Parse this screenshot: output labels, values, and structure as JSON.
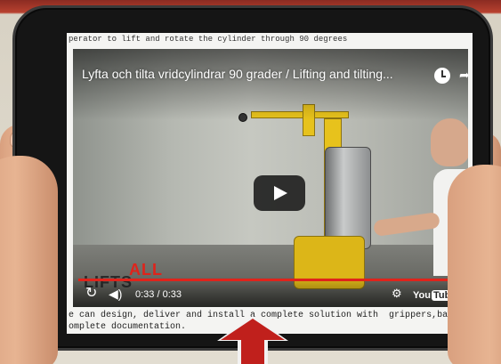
{
  "page": {
    "top_caption": "perator to lift and rotate the cylinder through 90 degrees",
    "body_text": "e can design, deliver and install a complete solution with  grippers,balancers and aluminium rail\nomplete documentation."
  },
  "video": {
    "title": "Lyfta och tilta vridcylindrar 90 grader / Lifting and tilting...",
    "time_display": "0:33 / 0:33",
    "progress": 1.0,
    "brand_lifts": "LIFTS",
    "brand_all": "ALL",
    "youtube_label": "You",
    "youtube_tube": "Tube"
  },
  "icons": {
    "clock": "clock-icon",
    "share": "share-icon",
    "play": "play-icon",
    "replay": "replay-icon",
    "volume": "volume-icon",
    "settings": "gear-icon",
    "fullscreen": "fullscreen-icon",
    "arrow": "arrow-up-icon"
  },
  "colors": {
    "accent": "#e0231b",
    "arrow": "#c0201c",
    "machine": "#e7c21c"
  }
}
